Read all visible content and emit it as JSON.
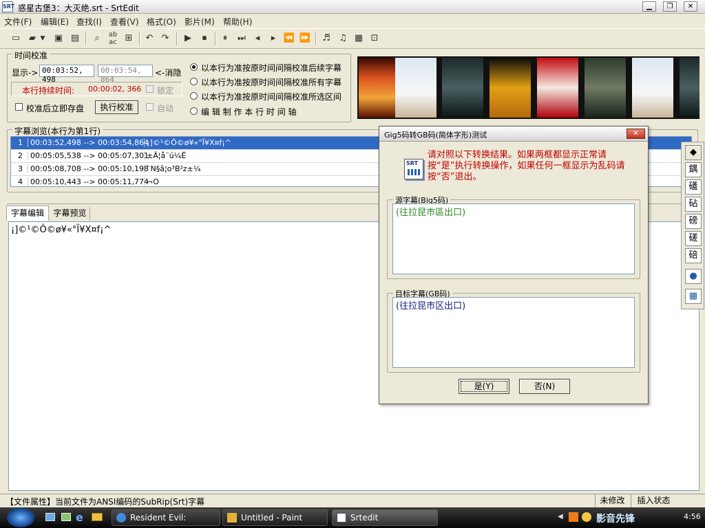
{
  "window": {
    "title": "惑星古堡3：大灭绝.srt - SrtEdit",
    "icon": "srt-app-icon",
    "buttons": [
      "minimize-icon",
      "restore-icon",
      "close-icon"
    ]
  },
  "menu": [
    "文件(F)",
    "编辑(E)",
    "查找(I)",
    "查看(V)",
    "格式(O)",
    "影片(M)",
    "帮助(H)"
  ],
  "toolbar": [
    "new-file-icon",
    "open-folder-icon",
    "dropdown-icon",
    "save-icon",
    "save-all-icon",
    "find-icon",
    "replace-icon",
    "preview-icon",
    "undo-icon",
    "redo-icon",
    "play-icon",
    "stop-icon",
    "pause-icon",
    "next-frame-icon",
    "previous-icon",
    "next-icon",
    "rewind-icon",
    "fast-forward-icon",
    "audio-icon",
    "audio-settings-icon",
    "video-icon",
    "settings-icon"
  ],
  "time_calib": {
    "legend": "时间校准",
    "show_label": "显示->",
    "show_value": "00:03:52, 498",
    "show_value2": "00:03:54, 864",
    "cancel_label": "<-消隐",
    "duration_label": "本行持续时间:",
    "duration_value": "00:00:02, 366",
    "lock_label": "锁定",
    "save_after_label": "校准后立即存盘",
    "execute_label": "执行校准",
    "auto_label": "自动",
    "options": [
      "以本行为准按原时间间隔校准后续字幕",
      "以本行为准按原时间间隔校准所有字幕",
      "以本行为准按原时间间隔校准所选区间",
      "编 辑 制 作 本 行 时 间 轴"
    ]
  },
  "subtitle_browse": {
    "legend": "字幕浏览(本行为第1行)",
    "rows": [
      {
        "num": "1",
        "time": "00:03:52,498 --> 00:03:54,864",
        "text": "¡]©¹©Ô©ø¥«°Ï¥X¤f¡^"
      },
      {
        "num": "2",
        "time": "00:05:05,538 --> 00:05:07,301",
        "text": "±Ä¦å¨ú¼Ë"
      },
      {
        "num": "3",
        "time": "00:05:08,708 --> 00:05:10,198",
        "text": "¨N§â¦o³B²z±¼"
      },
      {
        "num": "4",
        "time": "00:05:10,443 --> 00:05:11,774",
        "text": "¬O"
      }
    ]
  },
  "tabs": [
    "字幕编辑",
    "字幕预览"
  ],
  "editor_text": "¡]©¹©Ô©ø¥«°Ï¥X¤f¡^",
  "right_tools": [
    "鍝",
    "礚",
    "砧",
    "磅",
    "磋",
    "碚"
  ],
  "status": {
    "text": "【文件属性】当前文件为ANSI编码的SubRip(Srt)字幕",
    "modified": "未修改",
    "insert": "插入状态"
  },
  "taskbar": {
    "tasks": [
      "Resident Evil: Extinct...",
      "Untitled - Paint",
      "Srtedit"
    ],
    "tray_text": "影音先锋",
    "clock": "4:56"
  },
  "dialog": {
    "title": "Gig5码转GB码(简体字形)测试",
    "message": "请对照以下转换结果。如果两框都显示正常请按“是”执行转换操作，如果任何一框显示为乱码请按“否”退出。",
    "icon_label": "SRT",
    "source_label": "源字幕(Big5码)",
    "source_text": "(往拉昆市區出口)",
    "target_label": "目标字幕(GB码)",
    "target_text": "(往拉昆市区出口)",
    "yes_label": "是(Y)",
    "no_label": "否(N)"
  },
  "colors": {
    "selection": "#316ac5",
    "warning_red": "#c00000",
    "source_green": "#2e8b22",
    "target_navy": "#1a237e"
  }
}
